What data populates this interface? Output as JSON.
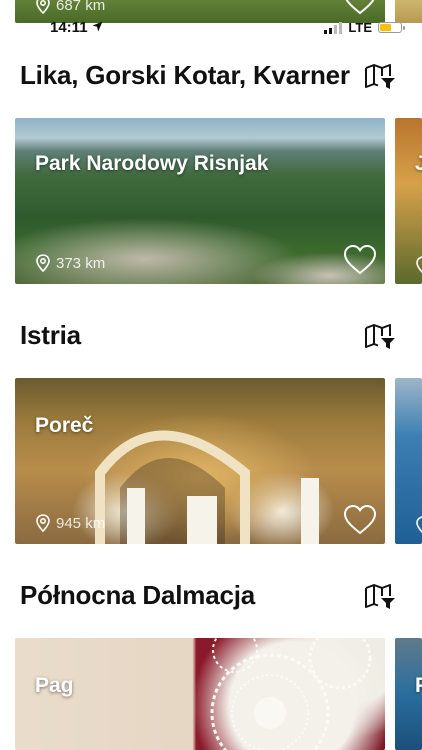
{
  "status_bar": {
    "time": "14:11",
    "network": "LTE",
    "battery_level": 0.6,
    "signal_bars": 2
  },
  "top_card": {
    "distance": "687 km"
  },
  "sections": [
    {
      "title": "Lika, Gorski Kotar, Kvarner",
      "card": {
        "title": "Park Narodowy Risnjak",
        "distance": "373 km"
      },
      "peek_title": "J"
    },
    {
      "title": "Istria",
      "card": {
        "title": "Poreč",
        "distance": "945 km"
      }
    },
    {
      "title": "Północna Dalmacja",
      "card": {
        "title": "Pag"
      },
      "peek_title": "P"
    }
  ],
  "icons": {
    "location": "location-pin-icon",
    "favorite": "heart-icon",
    "map": "map-filter-icon",
    "gps": "location-arrow-icon"
  },
  "colors": {
    "accent": "#111111",
    "battery": "#f4c20d"
  }
}
